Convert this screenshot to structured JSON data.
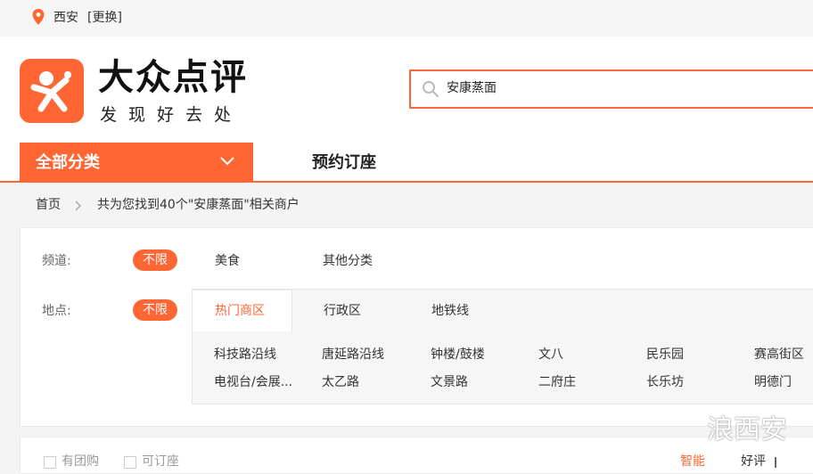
{
  "topbar": {
    "city": "西安",
    "change_label": "[更换]",
    "pin_icon": "location-pin-icon"
  },
  "brand": {
    "name": "大众点评",
    "slogan": "发现好去处",
    "logo_icon": "dianping-logo-icon"
  },
  "search": {
    "value": "安康蒸面",
    "icon": "search-icon"
  },
  "nav": {
    "all_categories": "全部分类",
    "reserve": "预约订座",
    "chevron_icon": "chevron-down-icon"
  },
  "breadcrumb": {
    "home": "首页",
    "result_text": "共为您找到40个\"安康蒸面\"相关商户"
  },
  "filters": {
    "channel": {
      "label": "频道:",
      "selected": "不限",
      "options": [
        "美食",
        "其他分类"
      ]
    },
    "location": {
      "label": "地点:",
      "selected": "不限",
      "tabs": [
        "热门商区",
        "行政区",
        "地铁线"
      ],
      "areas_row1": [
        "科技路沿线",
        "唐延路沿线",
        "钟楼/鼓楼",
        "文八",
        "民乐园",
        "赛高街区"
      ],
      "areas_row2": [
        "电视台/会展...",
        "太乙路",
        "文景路",
        "二府庄",
        "长乐坊",
        "明德门"
      ]
    }
  },
  "sortbar": {
    "groupon": "有团购",
    "bookable": "可订座",
    "smart": "智能",
    "good": "好评"
  },
  "watermark": "浪西安",
  "colors": {
    "accent": "#ff6633",
    "page_bg": "#f4f4f4"
  }
}
